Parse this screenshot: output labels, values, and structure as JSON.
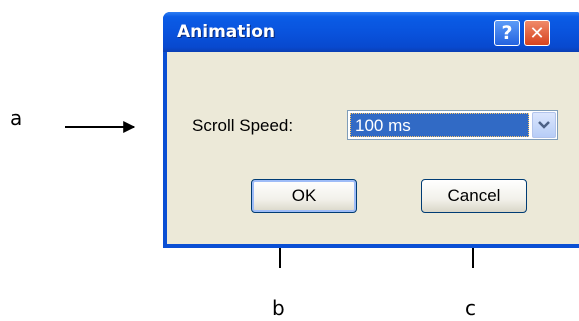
{
  "annotations": {
    "a": "a",
    "b": "b",
    "c": "c"
  },
  "dialog": {
    "title": "Animation",
    "help_glyph": "?",
    "close_glyph": "✕",
    "scroll_speed_label": "Scroll Speed:",
    "scroll_speed_value": "100 ms",
    "ok_label": "OK",
    "cancel_label": "Cancel"
  },
  "icons": {
    "help": "help-icon",
    "close": "close-icon",
    "dropdown": "chevron-down-icon"
  },
  "colors": {
    "titlebar": "#0953dd",
    "client_background": "#ece9d8",
    "selection": "#316ac5",
    "close_button": "#d6431e"
  }
}
